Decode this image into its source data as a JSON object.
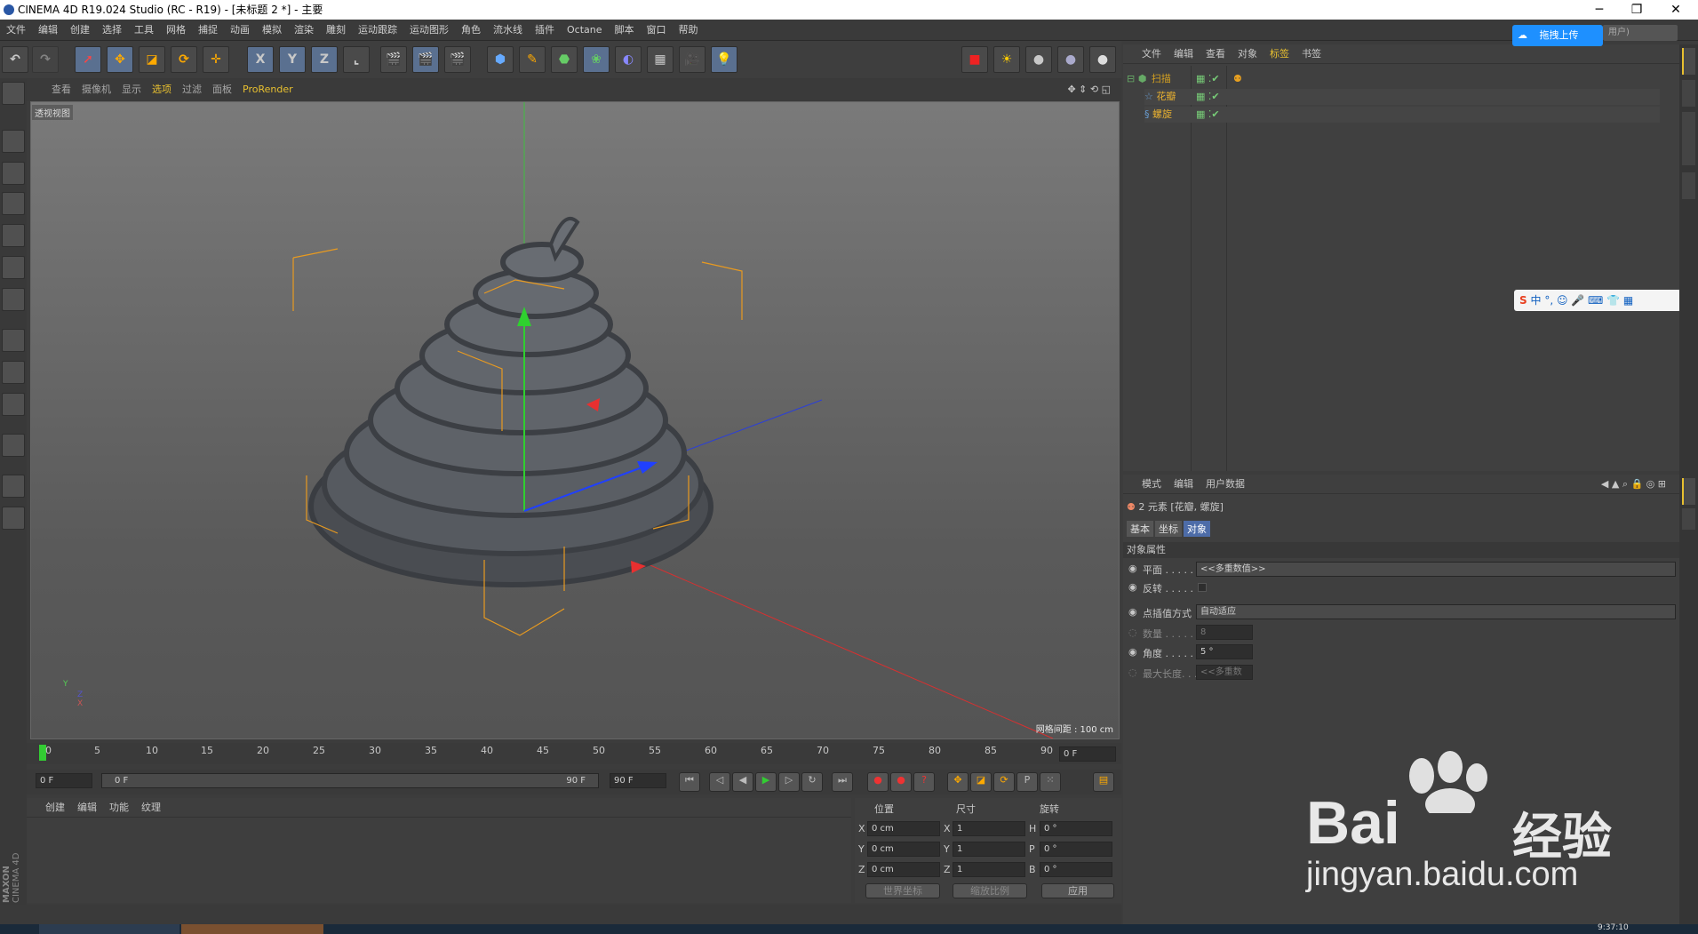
{
  "window": {
    "title": "CINEMA 4D R19.024 Studio (RC - R19) - [未标题 2 *] - 主要",
    "minimize": "─",
    "restore": "❐",
    "close": "✕"
  },
  "menu": [
    "文件",
    "编辑",
    "创建",
    "选择",
    "工具",
    "网格",
    "捕捉",
    "动画",
    "模拟",
    "渲染",
    "雕刻",
    "运动跟踪",
    "运动图形",
    "角色",
    "流水线",
    "插件",
    "Octane",
    "脚本",
    "窗口",
    "帮助"
  ],
  "toolbar": {
    "x": "X",
    "y": "Y",
    "z": "Z"
  },
  "viewport": {
    "menu": [
      "查看",
      "摄像机",
      "显示",
      "选项",
      "过滤",
      "面板",
      "ProRender"
    ],
    "label": "透视视图",
    "grid_info": "网格间距 : 100 cm",
    "axis_y": "Y",
    "axis_z": "Z",
    "axis_x": "X"
  },
  "timeline": {
    "ticks": [
      "0",
      "5",
      "10",
      "15",
      "20",
      "25",
      "30",
      "35",
      "40",
      "45",
      "50",
      "55",
      "60",
      "65",
      "70",
      "75",
      "80",
      "85",
      "90"
    ],
    "end_field": "0 F"
  },
  "timecontrols": {
    "start": "0 F",
    "range_start": "0 F",
    "range_end": "90 F",
    "end": "90 F"
  },
  "material_panel": {
    "menu": [
      "创建",
      "编辑",
      "功能",
      "纹理"
    ]
  },
  "coord_panel": {
    "headers": [
      "位置",
      "尺寸",
      "旋转"
    ],
    "rows": [
      {
        "a": "X",
        "pos": "0 cm",
        "s": "X",
        "size": "1",
        "r": "H",
        "rot": "0 °"
      },
      {
        "a": "Y",
        "pos": "0 cm",
        "s": "Y",
        "size": "1",
        "r": "P",
        "rot": "0 °"
      },
      {
        "a": "Z",
        "pos": "0 cm",
        "s": "Z",
        "size": "1",
        "r": "B",
        "rot": "0 °"
      }
    ],
    "world": "世界坐标",
    "scale": "缩放比例",
    "apply": "应用"
  },
  "object_manager": {
    "menu": [
      "文件",
      "编辑",
      "查看",
      "对象",
      "标签",
      "书签"
    ],
    "objects": [
      {
        "name": "扫描",
        "color": "#d4a020"
      },
      {
        "name": "花瓣",
        "color": "#e8b030"
      },
      {
        "name": "螺旋",
        "color": "#e8b030"
      }
    ]
  },
  "attributes": {
    "menu": [
      "模式",
      "编辑",
      "用户数据"
    ],
    "header": "2 元素 [花瓣, 螺旋]",
    "tabs": [
      "基本",
      "坐标",
      "对象"
    ],
    "section": "对象属性",
    "rows": [
      {
        "label": "平面 . . . . .",
        "value": "<<多重数值>>"
      },
      {
        "label": "反转 . . . . .",
        "value": ""
      },
      {
        "label": "点插值方式",
        "value": "自动适应"
      },
      {
        "label": "数量 . . . . .",
        "value": "8"
      },
      {
        "label": "角度 . . . . .",
        "value": "5 °"
      },
      {
        "label": "最大长度. . .",
        "value": "<<多重数"
      }
    ]
  },
  "cloud": {
    "upload": "拖拽上传",
    "user": "用户)"
  },
  "ime": {
    "label": "中"
  },
  "brand": {
    "maxon": "MAXON",
    "c4d": "CINEMA 4D"
  },
  "watermark": {
    "baidu": "Bai",
    "jingyan": "经验",
    "url": "jingyan.baidu.com"
  },
  "clock": "9:37:10"
}
